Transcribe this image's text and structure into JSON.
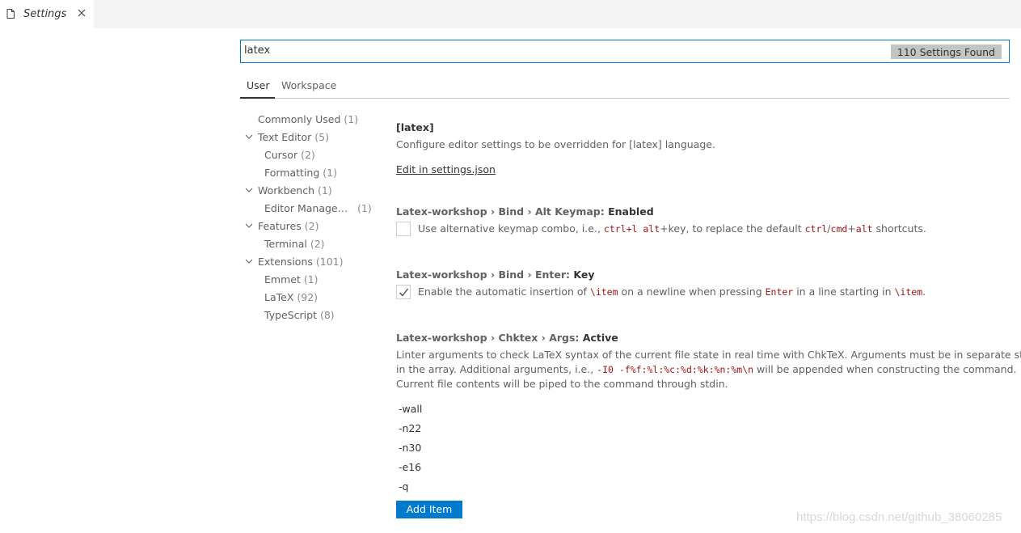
{
  "tab": {
    "title": "Settings"
  },
  "search": {
    "value": "latex",
    "result_count": "110 Settings Found"
  },
  "scope_tabs": {
    "user": "User",
    "workspace": "Workspace"
  },
  "toc": [
    {
      "label": "Commonly Used",
      "count": "(1)"
    },
    {
      "label": "Text Editor",
      "count": "(5)"
    },
    {
      "label": "Cursor",
      "count": "(2)"
    },
    {
      "label": "Formatting",
      "count": "(1)"
    },
    {
      "label": "Workbench",
      "count": "(1)"
    },
    {
      "label": "Editor Manage…",
      "count": "(1)"
    },
    {
      "label": "Features",
      "count": "(2)"
    },
    {
      "label": "Terminal",
      "count": "(2)"
    },
    {
      "label": "Extensions",
      "count": "(101)"
    },
    {
      "label": "Emmet",
      "count": "(1)"
    },
    {
      "label": "LaTeX",
      "count": "(92)"
    },
    {
      "label": "TypeScript",
      "count": "(8)"
    }
  ],
  "lang_section": {
    "title": "[latex]",
    "description": "Configure editor settings to be overridden for [latex] language.",
    "edit_link": "Edit in settings.json"
  },
  "alt_keymap": {
    "category": "Latex-workshop › Bind › Alt Keymap: ",
    "name": "Enabled",
    "checked": false,
    "desc_1": "Use alternative keymap combo, i.e., ",
    "code_1": "ctrl+l alt",
    "desc_2": "+key, to replace the default ",
    "code_2": "ctrl",
    "desc_3": "/",
    "code_3": "cmd",
    "desc_4": "+",
    "code_4": "alt",
    "desc_5": " shortcuts."
  },
  "enter_key": {
    "category": "Latex-workshop › Bind › Enter: ",
    "name": "Key",
    "checked": true,
    "desc_1": "Enable the automatic insertion of ",
    "code_1": "\\item",
    "desc_2": " on a newline when pressing ",
    "code_2": "Enter",
    "desc_3": " in a line starting in ",
    "code_3": "\\item",
    "desc_4": "."
  },
  "chktex": {
    "category": "Latex-workshop › Chktex › Args: ",
    "name": "Active",
    "line_1": "Linter arguments to check LaTeX syntax of the current file state in real time with ChkTeX. Arguments must be in separate strings",
    "line_2_a": "in the array. Additional arguments, i.e., ",
    "line_2_code": "-I0 -f%f:%l:%c:%d:%k:%n:%m\\n",
    "line_2_b": " will be appended when constructing the command.",
    "line_3": "Current file contents will be piped to the command through stdin.",
    "items": [
      "-wall",
      "-n22",
      "-n30",
      "-e16",
      "-q"
    ],
    "add_button": "Add Item"
  },
  "watermark": "https://blog.csdn.net/github_38060285"
}
